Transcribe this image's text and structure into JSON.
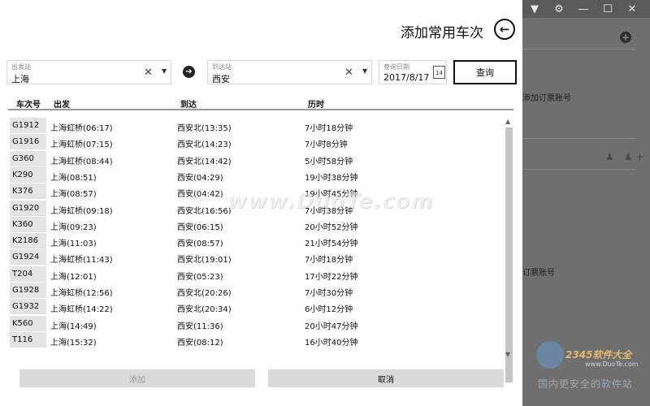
{
  "background_app": {
    "window_controls": {
      "menu_icon": "▼",
      "settings_icon": "⚙",
      "minimize": "—",
      "maximize": "☐",
      "close": "✕"
    },
    "add_icon": "+",
    "text_1": "添加订票账号",
    "text_2": "订票账号",
    "person_icons": "♟ ♟+"
  },
  "watermark": {
    "text": "www.DuoTe.com",
    "brand": "2345软件大全",
    "url": "www.DuoTe.com",
    "tagline": "国内更安全的软件站"
  },
  "dialog": {
    "title": "添加常用车次",
    "back_icon": "←",
    "from": {
      "label": "出发站",
      "value": "上海",
      "clear": "✕",
      "caret": "▼"
    },
    "swap_icon": "➔",
    "to": {
      "label": "到达站",
      "value": "西安",
      "clear": "✕",
      "caret": "▼"
    },
    "date": {
      "label": "查询日期",
      "value": "2017/8/17",
      "calendar_day": "14"
    },
    "query_button": "查询",
    "table": {
      "headers": [
        "车次号",
        "出发",
        "到达",
        "历时"
      ],
      "rows": [
        [
          "G1912",
          "上海虹桥(06:17)",
          "西安北(13:35)",
          "7小时18分钟"
        ],
        [
          "G1916",
          "上海虹桥(07:15)",
          "西安北(14:23)",
          "7小时8分钟"
        ],
        [
          "G360",
          "上海虹桥(08:44)",
          "西安北(14:42)",
          "5小时58分钟"
        ],
        [
          "K290",
          "上海(08:51)",
          "西安(04:29)",
          "19小时38分钟"
        ],
        [
          "K376",
          "上海(08:57)",
          "西安(04:42)",
          "19小时45分钟"
        ],
        [
          "G1920",
          "上海虹桥(09:18)",
          "西安北(16:56)",
          "7小时38分钟"
        ],
        [
          "K360",
          "上海(09:23)",
          "西安(06:15)",
          "20小时52分钟"
        ],
        [
          "K2186",
          "上海(11:03)",
          "西安(08:57)",
          "21小时54分钟"
        ],
        [
          "G1924",
          "上海虹桥(11:43)",
          "西安北(19:01)",
          "7小时18分钟"
        ],
        [
          "T204",
          "上海(12:01)",
          "西安(05:23)",
          "17小时22分钟"
        ],
        [
          "G1928",
          "上海虹桥(12:56)",
          "西安北(20:26)",
          "7小时30分钟"
        ],
        [
          "G1932",
          "上海虹桥(14:22)",
          "西安北(20:34)",
          "6小时12分钟"
        ],
        [
          "K560",
          "上海(14:49)",
          "西安(11:36)",
          "20小时47分钟"
        ],
        [
          "T116",
          "上海(15:32)",
          "西安(08:12)",
          "16小时40分钟"
        ]
      ]
    },
    "scroll_up": "▲",
    "scroll_down": "▼",
    "add_button": "添加",
    "cancel_button": "取消"
  }
}
